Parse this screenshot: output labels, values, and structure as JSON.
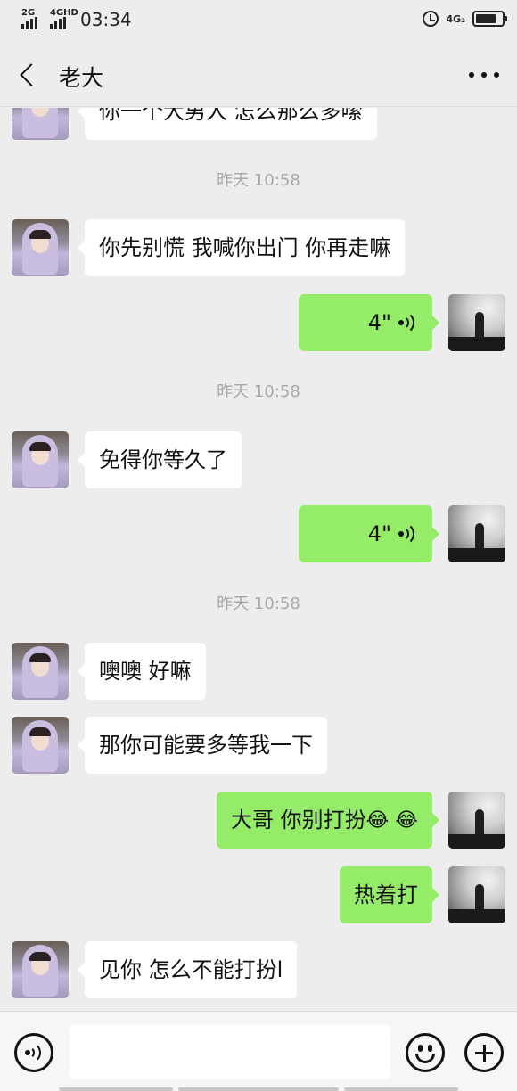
{
  "status_bar": {
    "net_left": "2G",
    "net_right": "4GHD",
    "time": "03:34",
    "net_4g": "4G₂"
  },
  "header": {
    "title": "老大"
  },
  "messages": [
    {
      "side": "left",
      "type": "text",
      "text": "你一个大男人 怎么那么多嗦"
    },
    {
      "type": "time",
      "text": "昨天 10:58"
    },
    {
      "side": "left",
      "type": "text",
      "text": "你先别慌 我喊你出门 你再走嘛"
    },
    {
      "side": "right",
      "type": "voice",
      "duration": "4\""
    },
    {
      "type": "time",
      "text": "昨天 10:58"
    },
    {
      "side": "left",
      "type": "text",
      "text": "免得你等久了"
    },
    {
      "side": "right",
      "type": "voice",
      "duration": "4\""
    },
    {
      "type": "time",
      "text": "昨天 10:58"
    },
    {
      "side": "left",
      "type": "text",
      "text": "噢噢 好嘛"
    },
    {
      "side": "left",
      "type": "text",
      "text": "那你可能要多等我一下"
    },
    {
      "side": "right",
      "type": "text",
      "text": "大哥   你别打扮",
      "emoji": "😂 😂"
    },
    {
      "side": "right",
      "type": "text",
      "text": "热着打"
    },
    {
      "side": "left",
      "type": "text",
      "text": "见你 怎么不能打扮l"
    }
  ],
  "composer": {
    "input_value": ""
  },
  "colors": {
    "background": "#ededed",
    "bubble_self": "#95ec69",
    "bubble_other": "#ffffff"
  }
}
